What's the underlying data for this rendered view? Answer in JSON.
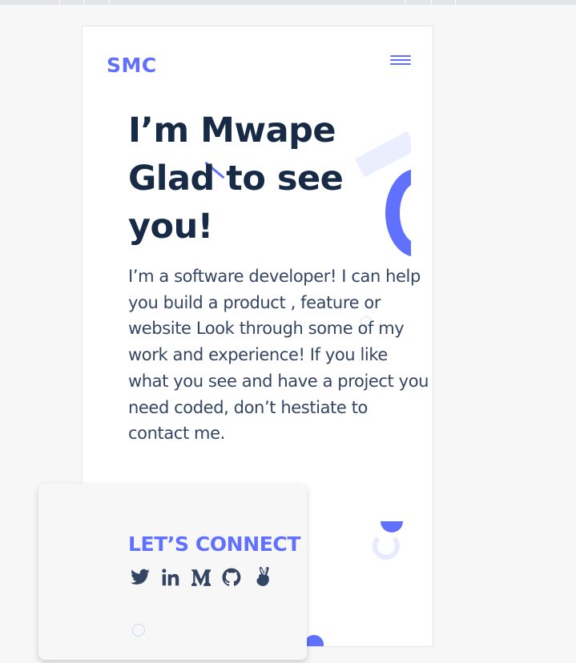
{
  "header": {
    "logo": "SMC"
  },
  "hero": {
    "title": "I’m Mwape\nGlad to see\nyou!",
    "description": "I’m a software developer! I can help you build a product , feature or website Look through some of my work and experience! If you like what you see and have a project you need coded, don’t hestiate to contact me."
  },
  "connect": {
    "title": "LET’S CONNECT",
    "links": [
      {
        "name": "twitter-icon"
      },
      {
        "name": "linkedin-icon"
      },
      {
        "name": "medium-icon"
      },
      {
        "name": "github-icon"
      },
      {
        "name": "angellist-icon"
      }
    ]
  },
  "colors": {
    "accent": "#6070ff",
    "heading": "#172a46",
    "text": "#344563",
    "accent_light": "#ebeeff"
  }
}
